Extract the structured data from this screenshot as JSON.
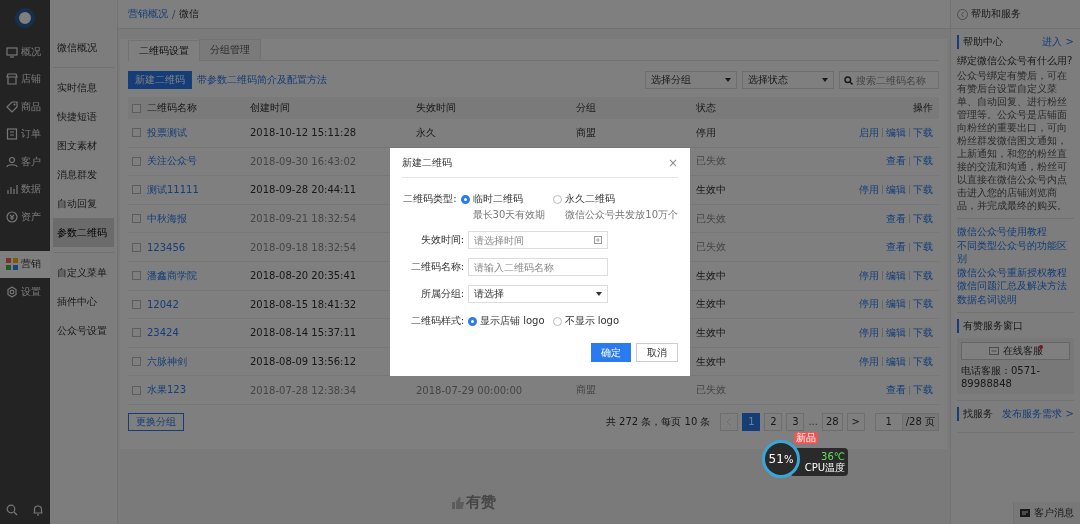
{
  "nav": {
    "items": [
      {
        "label": "概况",
        "selected": false
      },
      {
        "label": "店铺",
        "selected": false
      },
      {
        "label": "商品",
        "selected": false
      },
      {
        "label": "订单",
        "selected": false
      },
      {
        "label": "客户",
        "selected": false
      },
      {
        "label": "数据",
        "selected": false
      },
      {
        "label": "资产",
        "selected": false
      },
      {
        "label": "营销",
        "selected": true
      },
      {
        "label": "设置",
        "selected": false
      }
    ]
  },
  "subnav": {
    "groups": [
      [
        {
          "label": "微信概况",
          "selected": false
        }
      ],
      [
        {
          "label": "实时信息",
          "selected": false
        },
        {
          "label": "快捷短语",
          "selected": false
        },
        {
          "label": "图文素材",
          "selected": false
        },
        {
          "label": "消息群发",
          "selected": false
        },
        {
          "label": "自动回复",
          "selected": false
        },
        {
          "label": "参数二维码",
          "selected": true
        }
      ],
      [
        {
          "label": "自定义菜单",
          "selected": false
        },
        {
          "label": "插件中心",
          "selected": false
        },
        {
          "label": "公众号设置",
          "selected": false
        }
      ]
    ]
  },
  "breadcrumb": {
    "items": [
      "营销概况",
      "微信"
    ],
    "separator": "/"
  },
  "tabs": [
    {
      "label": "二维码设置",
      "selected": true
    },
    {
      "label": "分组管理",
      "selected": false
    }
  ],
  "toolbar": {
    "new_button": "新建二维码",
    "help_link": "带参数二维码简介及配置方法",
    "filters": [
      "选择分组",
      "选择状态"
    ],
    "search": {
      "placeholder": "搜索二维码名称"
    }
  },
  "table": {
    "select_all_checked": false,
    "columns": [
      "二维码名称",
      "创建时间",
      "失效时间",
      "分组",
      "状态",
      "操作"
    ],
    "rows": [
      {
        "checked": false,
        "expired": false,
        "name": "投票测试",
        "created": "2018-10-12 15:11:28",
        "expires": "永久",
        "group": "商盟",
        "status": "停用",
        "actions": [
          "启用",
          "编辑",
          "下载"
        ]
      },
      {
        "checked": false,
        "expired": true,
        "name": "关注公众号",
        "created": "2018-09-30 16:43:02",
        "status": "已失效",
        "actions": [
          "查看",
          "下载"
        ]
      },
      {
        "checked": false,
        "expired": false,
        "name": "测试11111",
        "created": "2018-09-28 20:44:11",
        "status": "生效中",
        "actions": [
          "停用",
          "编辑",
          "下载"
        ]
      },
      {
        "checked": false,
        "expired": true,
        "name": "中秋海报",
        "created": "2018-09-21 18:32:54",
        "status": "已失效",
        "actions": [
          "查看",
          "下载"
        ]
      },
      {
        "checked": false,
        "expired": true,
        "name": "123456",
        "created": "2018-09-18 18:32:54",
        "status": "已失效",
        "actions": [
          "查看",
          "下载"
        ]
      },
      {
        "checked": false,
        "expired": false,
        "name": "潘鑫商学院",
        "created": "2018-08-20 20:35:41",
        "status": "生效中",
        "actions": [
          "停用",
          "编辑",
          "下载"
        ]
      },
      {
        "checked": false,
        "expired": false,
        "name": "12042",
        "created": "2018-08-15 18:41:32",
        "status": "生效中",
        "actions": [
          "停用",
          "编辑",
          "下载"
        ]
      },
      {
        "checked": false,
        "expired": false,
        "name": "23424",
        "created": "2018-08-14 15:37:11",
        "status": "生效中",
        "actions": [
          "停用",
          "编辑",
          "下载"
        ]
      },
      {
        "checked": false,
        "expired": false,
        "name": "六脉神剑",
        "created": "2018-08-09 13:56:12",
        "status": "生效中",
        "actions": [
          "停用",
          "编辑",
          "下载"
        ]
      },
      {
        "checked": false,
        "expired": true,
        "name": "水果123",
        "created": "2018-07-28 12:38:34",
        "expires": "2018-07-29 00:00:00",
        "group": "商盟",
        "status": "已失效",
        "actions": [
          "查看",
          "下载"
        ]
      }
    ]
  },
  "batch_button": "更换分组",
  "pagination": {
    "summary": "共 272 条，每页 10 条",
    "prev_disabled": true,
    "pages": [
      {
        "kind": "page",
        "label": "1",
        "selected": true
      },
      {
        "kind": "page",
        "label": "2",
        "selected": false
      },
      {
        "kind": "page",
        "label": "3",
        "selected": false
      },
      {
        "kind": "ellipsis",
        "label": "..."
      },
      {
        "kind": "page",
        "label": "28",
        "selected": false
      }
    ],
    "next": ">",
    "page_input": "1",
    "total": "/28 页"
  },
  "footer_logo": "有赞",
  "help_panel": {
    "title": "帮助和服务",
    "center": {
      "title": "帮助中心",
      "enter_link": "进入 >",
      "question": "绑定微信公众号有什么用?",
      "answer": "公众号绑定有赞后，可在有赞后台设置自定义菜单、自动回复、进行粉丝管理等。公众号是店铺面向粉丝的重要出口，可向粉丝群发微信图文通知，上新通知，和您的粉丝直接的交流和沟通，粉丝可以直接在微信公众号内点击进入您的店铺浏览商品，并完成最终的购买。",
      "links": [
        "微信公众号使用教程",
        "不同类型公众号的功能区别",
        "微信公众号重新授权教程",
        "微信问题汇总及解决方法",
        "数据名词说明"
      ]
    },
    "service": {
      "title": "有赞服务窗口",
      "chat_button": "在线客服",
      "chat_unread": true,
      "phone": "电话客服：0571-89988848"
    },
    "find": {
      "title": "找服务",
      "link": "发布服务需求 >"
    },
    "messages_button": "客户消息"
  },
  "modal": {
    "title": "新建二维码",
    "close": "×",
    "type": {
      "label": "二维码类型:",
      "options": [
        {
          "label": "临时二维码",
          "hint": "最长30天有效期",
          "selected": true
        },
        {
          "label": "永久二维码",
          "hint": "微信公众号共发放10万个",
          "selected": false
        }
      ]
    },
    "expire": {
      "label": "失效时间:",
      "placeholder": "请选择时间"
    },
    "name": {
      "label": "二维码名称:",
      "placeholder": "请输入二维码名称"
    },
    "group": {
      "label": "所属分组:",
      "value": "请选择"
    },
    "style": {
      "label": "二维码样式:",
      "options": [
        {
          "label": "显示店铺 logo",
          "selected": true
        },
        {
          "label": "不显示 logo",
          "selected": false
        }
      ]
    },
    "buttons": [
      {
        "label": "确定",
        "kind": "primary"
      },
      {
        "label": "取消",
        "kind": "secondary"
      }
    ]
  },
  "cpu_widget": {
    "percent": "51",
    "unit": "%",
    "temp": "36℃",
    "label": "CPU温度",
    "badge": "新品"
  }
}
